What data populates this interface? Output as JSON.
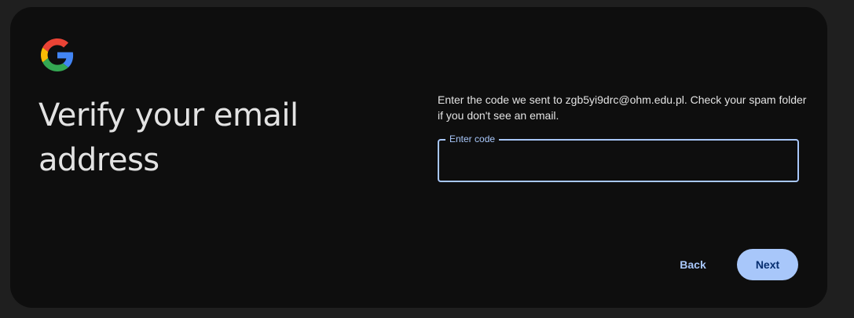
{
  "logo": {
    "icon": "google-g-icon"
  },
  "heading": {
    "title": "Verify your email address"
  },
  "instructions": {
    "text": "Enter the code we sent to zgb5yi9drc@ohm.edu.pl. Check your spam folder if you don't see an email."
  },
  "code_field": {
    "label": "Enter code",
    "value": ""
  },
  "buttons": {
    "back_label": "Back",
    "next_label": "Next"
  },
  "colors": {
    "page_background": "#1f1f1f",
    "card_background": "#0e0e0e",
    "accent": "#a8c7fa",
    "accent_text": "#062e6f",
    "text_primary": "#e3e3e3",
    "google_blue": "#4285F4",
    "google_red": "#EA4335",
    "google_yellow": "#FBBC05",
    "google_green": "#34A853"
  }
}
